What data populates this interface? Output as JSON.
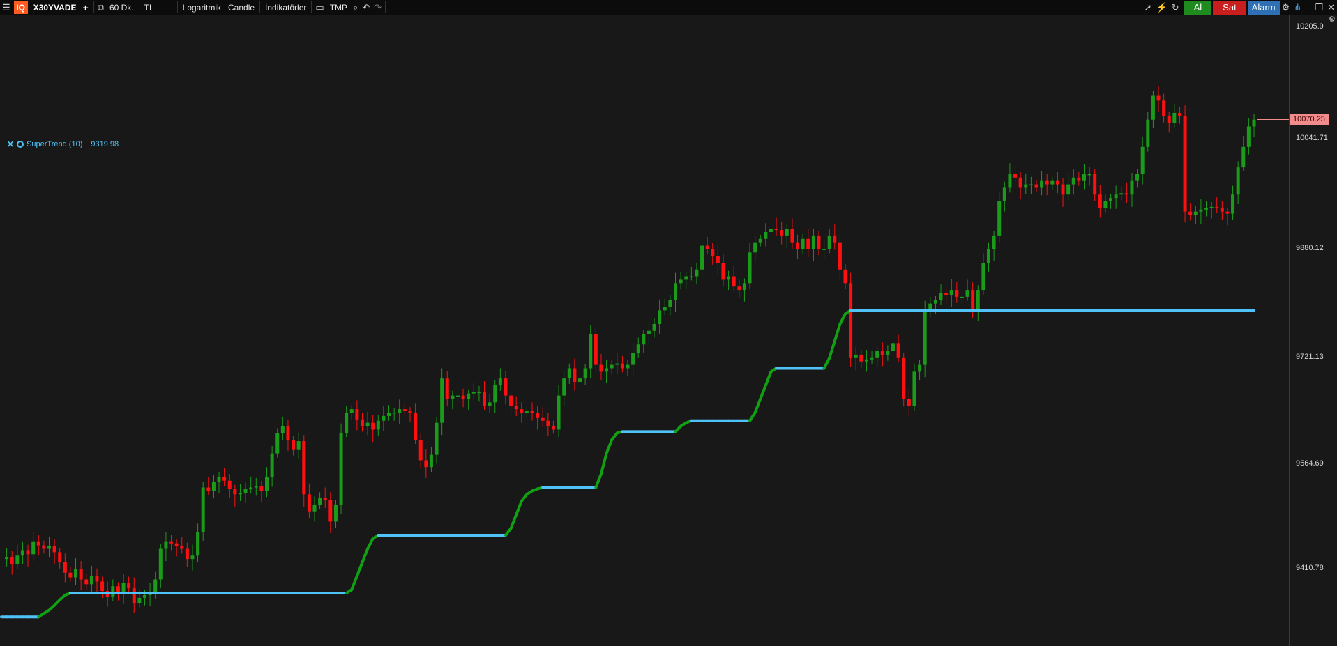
{
  "toolbar": {
    "symbol": "X30YVADE",
    "add": "+",
    "interval": "60 Dk.",
    "currency": "TL",
    "scale": "Logaritmik",
    "chart_style": "Candle",
    "indicators": "İndikatörler",
    "template": "TMP",
    "buy": "Al",
    "sell": "Sat",
    "alarm": "Alarm"
  },
  "legend": {
    "name": "SuperTrend (10)",
    "value": "9319.98"
  },
  "axis": {
    "ticks": [
      "10205.9",
      "10041.71",
      "9880.12",
      "9721.13",
      "9564.69",
      "9410.78"
    ],
    "last_price": "10070.25"
  },
  "colors": {
    "up": "#1a9c1a",
    "down": "#ff1010",
    "trend_up": "#11a011",
    "trend_down": "#ff1a1a",
    "flat": "#4fc3f7"
  },
  "chart_data": {
    "type": "line",
    "title": "",
    "xlabel": "",
    "ylabel": "",
    "ylim": [
      9330,
      10215
    ],
    "y_ticks": [
      10205.9,
      10041.71,
      9880.12,
      9721.13,
      9564.69,
      9410.78
    ],
    "price_series": [
      9425,
      9428,
      9418,
      9430,
      9438,
      9432,
      9450,
      9445,
      9440,
      9444,
      9435,
      9420,
      9405,
      9398,
      9410,
      9395,
      9388,
      9400,
      9392,
      9378,
      9370,
      9385,
      9376,
      9390,
      9382,
      9360,
      9368,
      9372,
      9375,
      9395,
      9440,
      9450,
      9448,
      9444,
      9440,
      9425,
      9430,
      9465,
      9530,
      9525,
      9538,
      9545,
      9540,
      9528,
      9520,
      9522,
      9528,
      9530,
      9532,
      9525,
      9545,
      9580,
      9610,
      9620,
      9600,
      9585,
      9598,
      9520,
      9495,
      9505,
      9515,
      9512,
      9480,
      9505,
      9610,
      9640,
      9645,
      9630,
      9620,
      9625,
      9615,
      9628,
      9635,
      9640,
      9640,
      9645,
      9642,
      9640,
      9600,
      9570,
      9560,
      9578,
      9625,
      9690,
      9660,
      9665,
      9665,
      9660,
      9668,
      9670,
      9670,
      9650,
      9655,
      9680,
      9690,
      9665,
      9650,
      9645,
      9640,
      9642,
      9640,
      9632,
      9628,
      9620,
      9615,
      9665,
      9690,
      9705,
      9685,
      9690,
      9705,
      9755,
      9710,
      9700,
      9705,
      9710,
      9712,
      9705,
      9710,
      9728,
      9740,
      9755,
      9760,
      9770,
      9790,
      9795,
      9805,
      9830,
      9835,
      9840,
      9840,
      9850,
      9885,
      9880,
      9870,
      9860,
      9835,
      9840,
      9825,
      9820,
      9830,
      9875,
      9890,
      9895,
      9905,
      9910,
      9908,
      9900,
      9910,
      9890,
      9880,
      9895,
      9880,
      9900,
      9880,
      9880,
      9900,
      9890,
      9850,
      9830,
      9720,
      9725,
      9715,
      9718,
      9720,
      9730,
      9725,
      9730,
      9742,
      9720,
      9660,
      9650,
      9700,
      9710,
      9790,
      9800,
      9805,
      9815,
      9812,
      9820,
      9810,
      9810,
      9820,
      9790,
      9820,
      9860,
      9880,
      9900,
      9950,
      9970,
      9990,
      9985,
      9970,
      9975,
      9975,
      9970,
      9980,
      9975,
      9980,
      9975,
      9960,
      9975,
      9985,
      9980,
      9990,
      9990,
      9960,
      9940,
      9950,
      9955,
      9960,
      9962,
      9960,
      9980,
      9990,
      10030,
      10070,
      10105,
      10098,
      10075,
      10065,
      10080,
      10075,
      9935,
      9930,
      9935,
      9938,
      9940,
      9942,
      9940,
      9935,
      9932,
      9960,
      10000,
      10030,
      10060,
      10070
    ],
    "supertrend": [
      9340,
      9340,
      9340,
      9340,
      9340,
      9340,
      9340,
      9340,
      9345,
      9350,
      9357,
      9365,
      9372,
      9375,
      9375,
      9375,
      9375,
      9375,
      9375,
      9375,
      9375,
      9375,
      9375,
      9375,
      9375,
      9375,
      9375,
      9375,
      9375,
      9375,
      9375,
      9375,
      9375,
      9375,
      9375,
      9375,
      9375,
      9375,
      9375,
      9375,
      9375,
      9375,
      9375,
      9375,
      9375,
      9375,
      9375,
      9375,
      9375,
      9375,
      9375,
      9375,
      9375,
      9375,
      9375,
      9375,
      9375,
      9375,
      9375,
      9375,
      9375,
      9375,
      9375,
      9375,
      9375,
      9375,
      9380,
      9400,
      9420,
      9440,
      9455,
      9460,
      9460,
      9460,
      9460,
      9460,
      9460,
      9460,
      9460,
      9460,
      9460,
      9460,
      9460,
      9460,
      9460,
      9460,
      9460,
      9460,
      9460,
      9460,
      9460,
      9460,
      9460,
      9460,
      9460,
      9460,
      9470,
      9490,
      9510,
      9520,
      9525,
      9528,
      9530,
      9530,
      9530,
      9530,
      9530,
      9530,
      9530,
      9530,
      9530,
      9530,
      9530,
      9550,
      9580,
      9600,
      9610,
      9612,
      9612,
      9612,
      9612,
      9612,
      9612,
      9612,
      9612,
      9612,
      9612,
      9612,
      9620,
      9625,
      9628,
      9628,
      9628,
      9628,
      9628,
      9628,
      9628,
      9628,
      9628,
      9628,
      9628,
      9628,
      9640,
      9660,
      9680,
      9700,
      9705,
      9705,
      9705,
      9705,
      9705,
      9705,
      9705,
      9705,
      9705,
      9705,
      9720,
      9745,
      9770,
      9785,
      9790,
      9790,
      9790,
      9790,
      9790,
      9790,
      9790,
      9790,
      9790,
      9790,
      9790,
      9790,
      9790,
      9790,
      9790,
      9790,
      9790,
      9790,
      9790,
      9790,
      9790,
      9790,
      9790,
      9790,
      9790,
      9790,
      9790,
      9790,
      9790,
      9790,
      9790,
      9790,
      9790,
      9790,
      9790,
      9790,
      9790,
      9790,
      9790,
      9790,
      9790,
      9790,
      9790,
      9790,
      9790,
      9790,
      9790,
      9790,
      9790,
      9790,
      9790,
      9790,
      9790,
      9790,
      9790,
      9790,
      9790,
      9790,
      9790,
      9790,
      9790,
      9790,
      9790,
      9790,
      9790,
      9790,
      9790,
      9790,
      9790,
      9790,
      9790,
      9790,
      9790,
      9790,
      9790,
      9790,
      9790,
      9790,
      9790,
      9790,
      9790,
      9790,
      9790,
      9790,
      9790
    ]
  }
}
